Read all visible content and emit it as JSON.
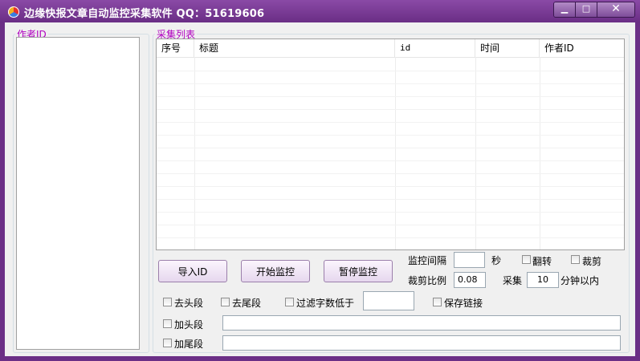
{
  "window": {
    "title": "边缘快报文章自动监控采集软件 QQ：51619606",
    "minimize": "▁",
    "maximize": "□",
    "close": "✕"
  },
  "authors_group": {
    "legend": "作者ID"
  },
  "collect_group": {
    "legend": "采集列表"
  },
  "table": {
    "columns": [
      "序号",
      "标题",
      "id",
      "时间",
      "作者ID"
    ],
    "rows": []
  },
  "buttons": {
    "import": "导入ID",
    "start": "开始监控",
    "pause": "暂停监控"
  },
  "settings": {
    "interval_label": "监控间隔",
    "interval_value": "",
    "seconds_unit": "秒",
    "flip_label": "翻转",
    "crop_label": "裁剪",
    "crop_ratio_label": "裁剪比例",
    "crop_ratio_value": "0.08",
    "collect_label": "采集",
    "collect_minutes_value": "10",
    "minutes_within_label": "分钟以内",
    "remove_head_label": "去头段",
    "remove_tail_label": "去尾段",
    "filter_words_label": "过滤字数低于",
    "filter_words_value": "",
    "keep_links_label": "保存链接",
    "add_head_label": "加头段",
    "add_head_value": "",
    "add_tail_label": "加尾段",
    "add_tail_value": ""
  }
}
